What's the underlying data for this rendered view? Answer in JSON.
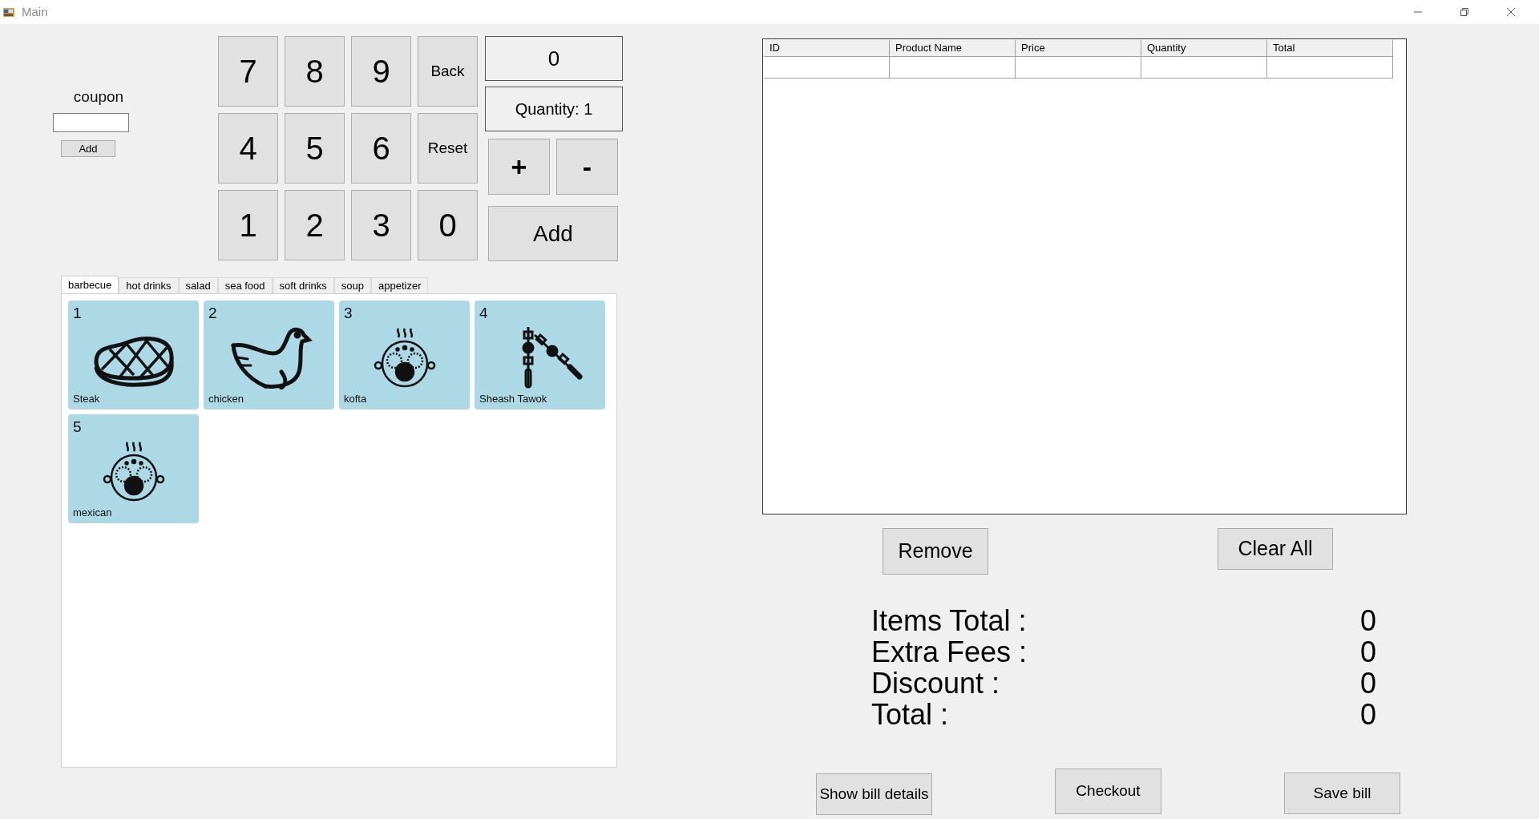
{
  "window": {
    "title": "Main"
  },
  "coupon": {
    "label": "coupon",
    "button": "Add"
  },
  "keypad": [
    "7",
    "8",
    "9",
    "Back",
    "4",
    "5",
    "6",
    "Reset",
    "1",
    "2",
    "3",
    "0"
  ],
  "display": "0",
  "quantity": "Quantity: 1",
  "plus": "+",
  "minus": "-",
  "add_button": "Add",
  "tabs": [
    {
      "label": "barbecue",
      "selected": true
    },
    {
      "label": "hot drinks",
      "selected": false
    },
    {
      "label": "salad",
      "selected": false
    },
    {
      "label": "sea food",
      "selected": false
    },
    {
      "label": "soft drinks",
      "selected": false
    },
    {
      "label": "soup",
      "selected": false
    },
    {
      "label": "appetizer",
      "selected": false
    }
  ],
  "products": [
    {
      "number": "1",
      "name": "Steak",
      "kind": "steak"
    },
    {
      "number": "2",
      "name": "chicken",
      "kind": "chicken"
    },
    {
      "number": "3",
      "name": "kofta",
      "kind": "bowl"
    },
    {
      "number": "4",
      "name": "Sheash Tawok",
      "kind": "skewer"
    },
    {
      "number": "5",
      "name": "mexican",
      "kind": "bowl"
    }
  ],
  "table": {
    "columns": [
      "ID",
      "Product Name",
      "Price",
      "Quantity",
      "Total"
    ]
  },
  "remove_button": "Remove",
  "clear_button": "Clear All",
  "summary": [
    {
      "label": "Items Total :",
      "value": "0"
    },
    {
      "label": "Extra Fees :",
      "value": "0"
    },
    {
      "label": "Discount :",
      "value": "0"
    },
    {
      "label": "Total :",
      "value": "0"
    }
  ],
  "bottom_buttons": [
    "Show bill details",
    "Checkout",
    "Save bill"
  ]
}
